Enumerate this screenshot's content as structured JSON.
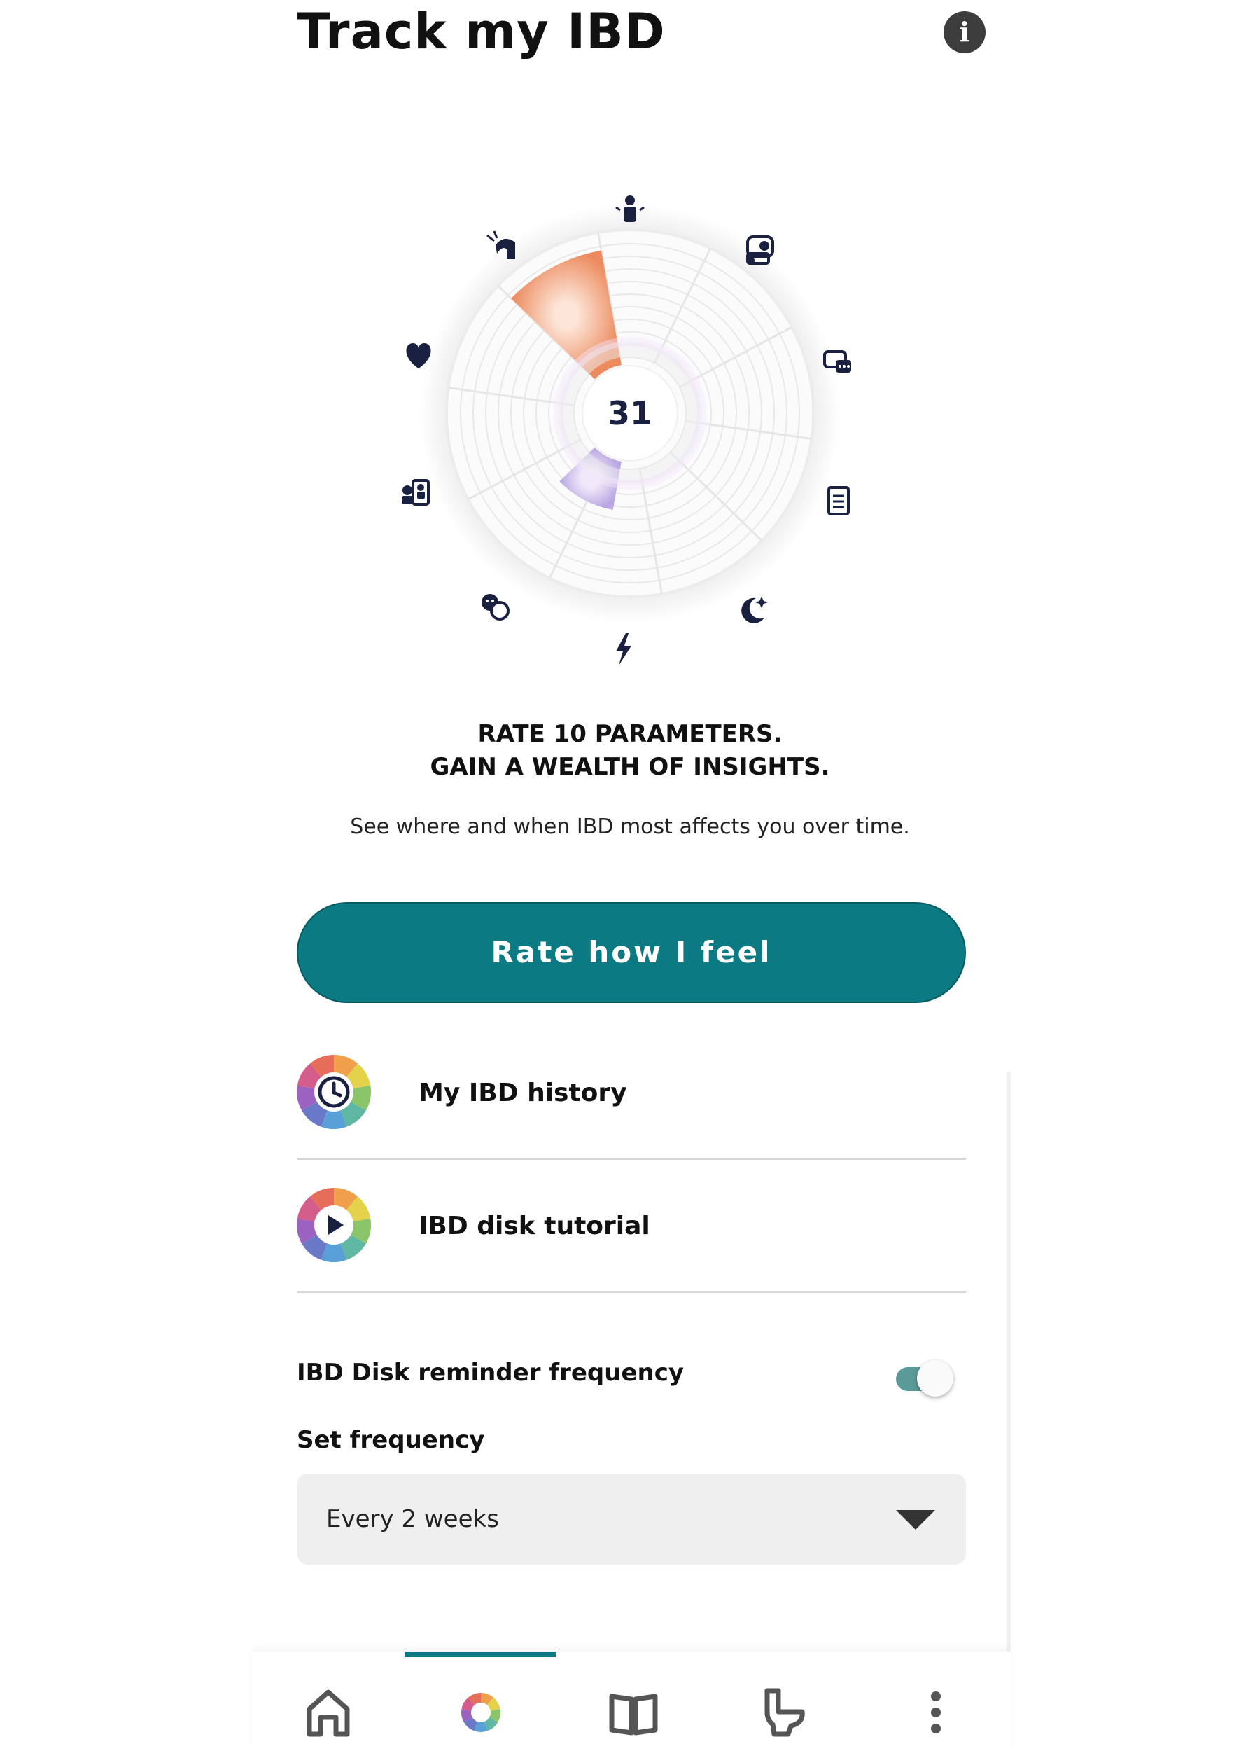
{
  "header": {
    "title": "Track my IBD",
    "info_icon": "info-icon"
  },
  "disk": {
    "score": "31",
    "parameter_icons": [
      "person-work-icon",
      "mood-faces-icon",
      "sleep-moon-icon",
      "energy-bolt-icon",
      "stress-faces-icon",
      "interpersonal-icon",
      "heart-icon",
      "joint-pain-icon",
      "toilet-roll-icon",
      "chat-icon",
      "document-icon"
    ],
    "colors": {
      "highlight": "#ec8b5e",
      "secondary": "#c3b4e6",
      "navy": "#1a2140"
    }
  },
  "intro": {
    "line1": "RATE 10 PARAMETERS.",
    "line2": "GAIN A WEALTH OF INSIGHTS.",
    "subtitle": "See where and when IBD most affects you over time."
  },
  "actions": {
    "rate_button": "Rate how I feel",
    "history_label": "My IBD history",
    "tutorial_label": "IBD disk tutorial"
  },
  "reminder": {
    "label": "IBD Disk reminder frequency",
    "enabled": true,
    "frequency_label": "Set frequency",
    "frequency_value": "Every 2 weeks"
  },
  "nav": {
    "items": [
      "home-icon",
      "ibd-disk-icon",
      "book-icon",
      "toilet-icon",
      "more-icon"
    ],
    "active": "ibd-disk-icon",
    "accent": "#0b7a82"
  }
}
